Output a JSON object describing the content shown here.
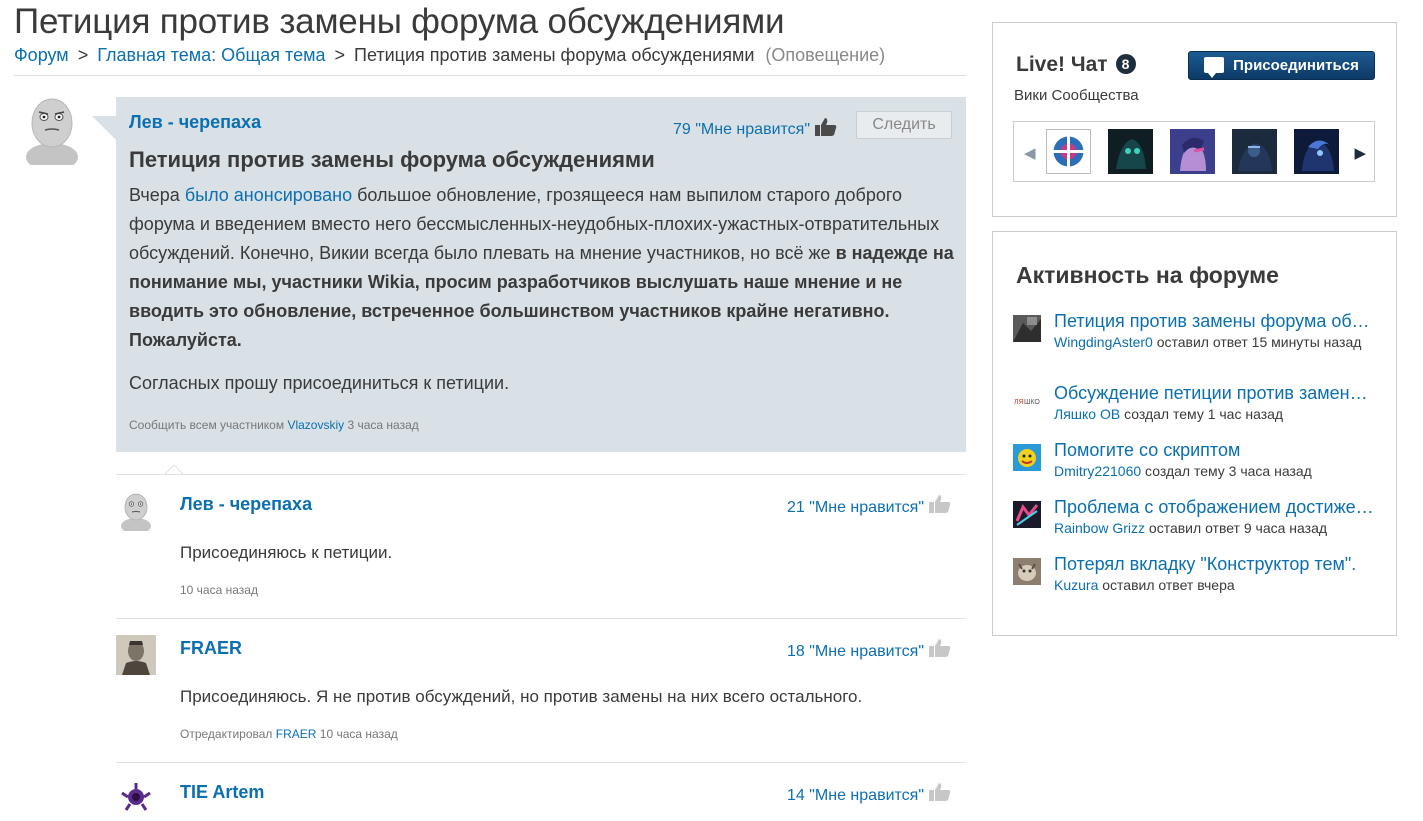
{
  "page": {
    "title": "Петиция против замены форума обсуждениями"
  },
  "breadcrumb": {
    "items": [
      "Форум",
      "Главная тема: Общая тема",
      "Петиция против замены форума обсуждениями"
    ],
    "separator": ">",
    "note": "(Оповещение)"
  },
  "post": {
    "author": "Лев - черепаха",
    "likes": "79 \"Мне нравится\"",
    "follow_label": "Следить",
    "title": "Петиция против замены форума обсуждениями",
    "body_pre": "Вчера ",
    "body_link": "было анонсировано",
    "body_mid": " большое обновление, грозящееся нам выпилом старого доброго форума и введением вместо него бессмысленных-неудобных-плохих-ужастных-отвратительных обсуждений. Конечно, Викии всегда было плевать на мнение участников, но всё же ",
    "body_bold": "в надежде на понимание мы, участники Wikia, просим разработчиков выслушать наше мнение и не вводить это обновление, встреченное большинством участников крайне негативно. Пожалуйста.",
    "body2": "Согласных прошу присоединиться к петиции.",
    "meta_prefix": "Сообщить всем участником",
    "meta_user": "Vlazovskiy",
    "meta_time": "3 часа назад"
  },
  "replies": [
    {
      "author": "Лев - черепаха",
      "likes": "21 \"Мне нравится\"",
      "text": "Присоединяюсь к петиции.",
      "meta_prefix": "",
      "meta_user": "",
      "meta_time": "10 часа назад"
    },
    {
      "author": "FRAER",
      "likes": "18 \"Мне нравится\"",
      "text": "Присоединяюсь. Я не против обсуждений, но против замены на них всего остального.",
      "meta_prefix": "Отредактировал",
      "meta_user": "FRAER",
      "meta_time": "10 часа назад"
    },
    {
      "author": "TIE Artem",
      "likes": "14 \"Мне нравится\"",
      "text": "",
      "meta_prefix": "",
      "meta_user": "",
      "meta_time": ""
    }
  ],
  "chat": {
    "title": "Live! Чат",
    "count": "8",
    "subtitle": "Вики Сообщества",
    "join_label": "Присоединиться"
  },
  "activity": {
    "title": "Активность на форуме",
    "items": [
      {
        "title": "Петиция против замены форума обсуждениями",
        "user": "WingdingAster0",
        "action": "оставил ответ 15 минуты назад"
      },
      {
        "title": "Обсуждение петиции против замены форума",
        "user": "Ляшко ОВ",
        "action": "создал тему 1 час назад"
      },
      {
        "title": "Помогите со скриптом",
        "user": "Dmitry221060",
        "action": "создал тему 3 часа назад"
      },
      {
        "title": "Проблема с отображением достижений",
        "user": "Rainbow Grizz",
        "action": "оставил ответ 9 часа назад"
      },
      {
        "title": "Потерял вкладку \"Конструктор тем\".",
        "user": "Kuzura",
        "action": "оставил ответ вчера"
      }
    ]
  },
  "colors": {
    "link": "#0b6fb0",
    "post_bg": "#d9e1e6",
    "join_btn": "#0d3a66"
  }
}
